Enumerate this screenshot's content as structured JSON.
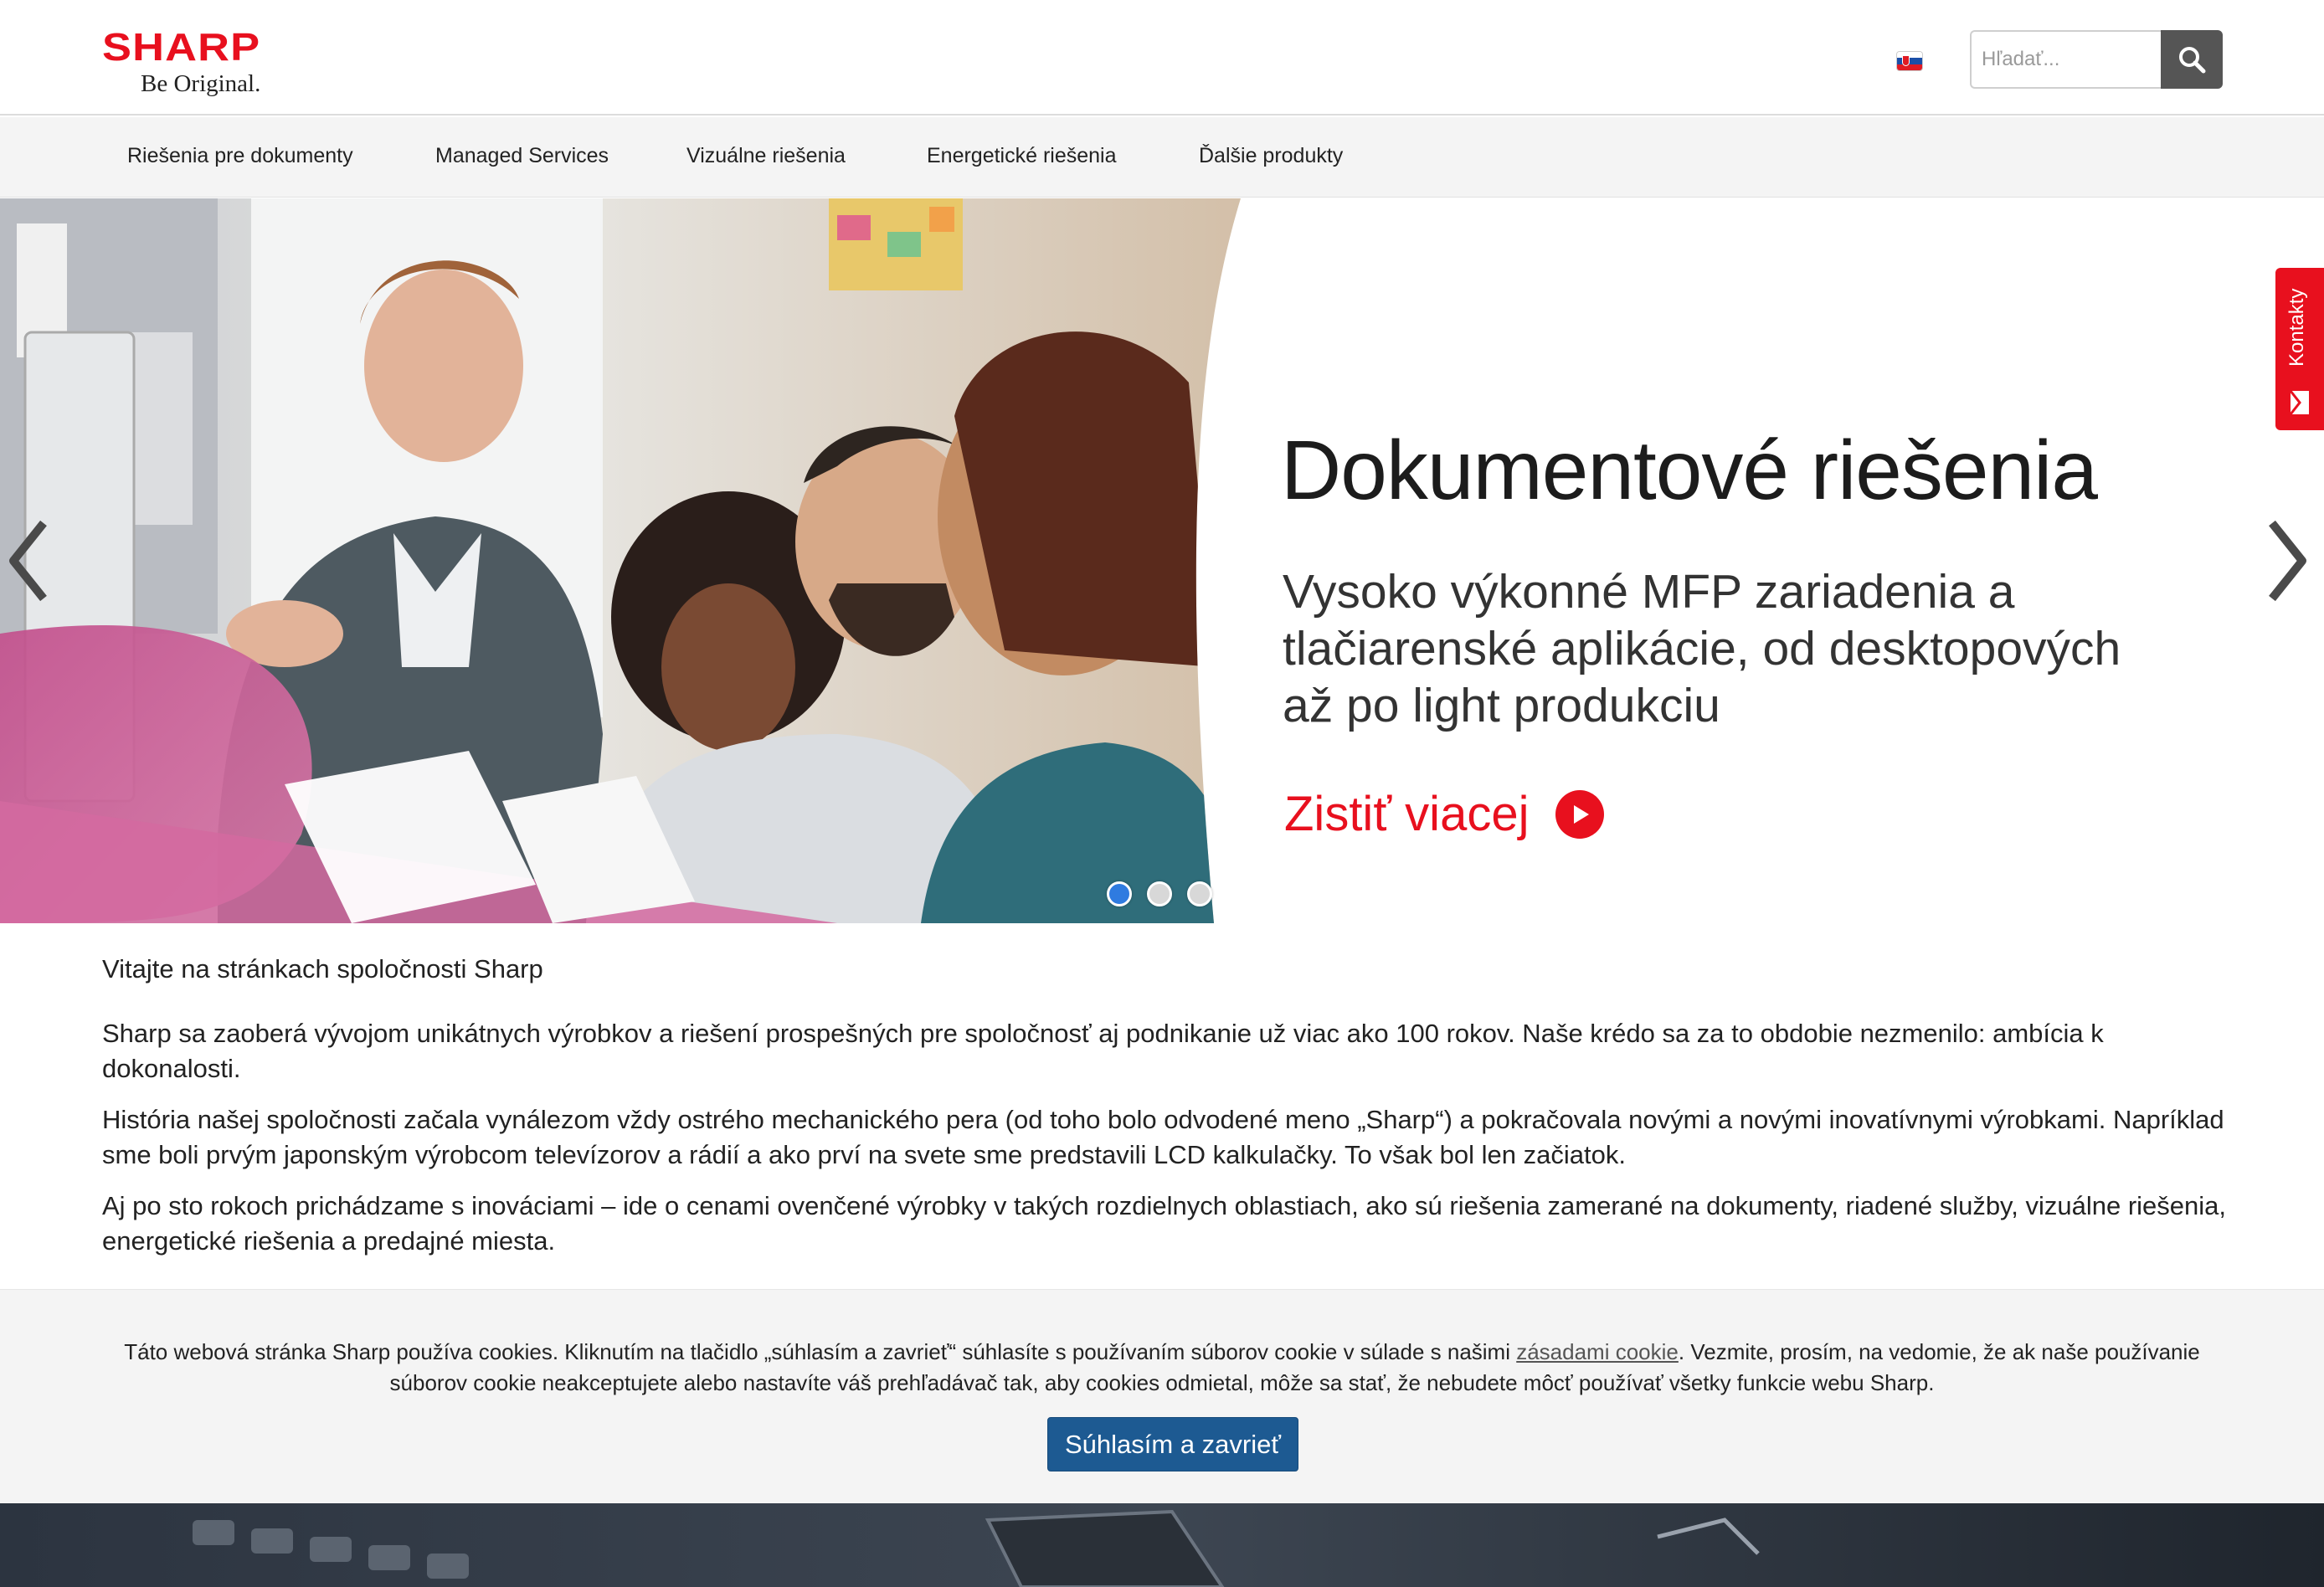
{
  "header": {
    "logo_word": "SHARP",
    "logo_tagline": "Be Original.",
    "language_flag": "slovakia-flag-icon",
    "search_placeholder": "Hľadať...",
    "search_icon": "search-icon"
  },
  "nav": {
    "items": [
      {
        "label": "Riešenia pre dokumenty"
      },
      {
        "label": "Managed Services"
      },
      {
        "label": "Vizuálne riešenia"
      },
      {
        "label": "Energetické riešenia"
      },
      {
        "label": "Ďalšie produkty"
      }
    ]
  },
  "hero": {
    "title": "Dokumentové riešenia",
    "subtitle": "Vysoko výkonné MFP zariadenia a tlačiarenské aplikácie, od desktopových až po light produkciu",
    "cta_label": "Zistiť viacej",
    "slide_count": 3,
    "active_slide": 1
  },
  "side_tab": {
    "label": "Kontakty",
    "icon": "mail-icon"
  },
  "content": {
    "welcome": "Vitajte na stránkach spoločnosti Sharp",
    "paragraphs": [
      "Sharp sa zaoberá vývojom unikátnych výrobkov a riešení prospešných pre spoločnosť aj podnikanie už viac ako 100 rokov. Naše krédo sa za to obdobie nezmenilo: ambícia k dokonalosti.",
      "História našej spoločnosti začala vynálezom vždy ostrého mechanického pera (od toho bolo odvodené meno „Sharp“) a pokračovala novými a novými inovatívnymi výrobkami. Napríklad sme boli prvým japonským výrobcom televízorov a rádií a ako prví na svete sme predstavili LCD kalkulačky. To však bol len začiatok.",
      "Aj po sto rokoch prichádzame s inováciami – ide o cenami ovenčené výrobky v takých rozdielnych oblastiach, ako sú riešenia zamerané na dokumenty, riadené služby, vizuálne riešenia, energetické riešenia a predajné miesta."
    ]
  },
  "cookie": {
    "text_before": "Táto webová stránka Sharp používa cookies. Kliknutím na tlačidlo „súhlasím a zavrieť“ súhlasíte s používaním súborov cookie v súlade s našimi ",
    "link_text": "zásadami cookie",
    "text_after": ". Vezmite, prosím, na vedomie, že ak naše používanie súborov cookie neakceptujete alebo nastavíte váš prehľadávač tak, aby cookies odmietal, môže sa stať, že nebudete môcť používať všetky funkcie webu Sharp.",
    "button_label": "Súhlasím a zavrieť"
  },
  "colors": {
    "brand_red": "#e8101e",
    "nav_bg": "#f4f4f4",
    "cookie_button": "#1d5a92",
    "active_dot": "#2f7be0",
    "hero_pink": "#d0669a"
  }
}
